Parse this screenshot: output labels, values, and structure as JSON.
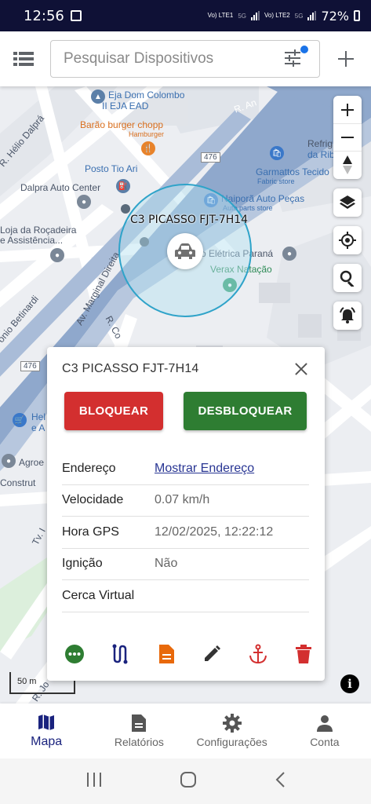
{
  "status_bar": {
    "time": "12:56",
    "sim1": "Vo) LTE1",
    "sim2": "Vo) LTE2",
    "network_badge": "5G",
    "battery": "72%"
  },
  "app_bar": {
    "menu_icon": "list-icon",
    "search_placeholder": "Pesquisar Dispositivos",
    "filter_icon": "filter-sliders-icon",
    "add_icon": "plus-icon"
  },
  "map": {
    "labels": {
      "eja": "Eja Dom Colombo",
      "eja2": "II EJA EAD",
      "barao": "Barão burger chopp",
      "hamburger": "Hamburger",
      "posto": "Posto Tio Ari",
      "dalpra": "Dalpra Auto Center",
      "helio": "R. Hélio Dalprá",
      "loja1": "Loja da Roçadeira",
      "loja2": "e Assistência...",
      "garmattos": "Garmattos Tecido",
      "fabric": "Fabric store",
      "refrig1": "Refrig",
      "refrig2": "da Rib",
      "naipora": "Naiporã Auto Peças",
      "autoparts": "Auto parts store",
      "eletrica": "o Elétrica Paraná",
      "verax": "Verax Natação",
      "marginal": "Av. Marginal Direita",
      "betinardi": "onio Betinardi",
      "rua_r": "R. Co",
      "agro": "Agroe",
      "construt": "Construt",
      "hel1": "Hel",
      "hel2": "e A",
      "route476a": "476",
      "route476b": "476",
      "rua_an": "R. An",
      "tv": "Tv. I",
      "rua_bottom": "R. Jo"
    },
    "vehicle_label": "C3 PICASSO FJT-7H14",
    "scale": "50 m",
    "info": "i"
  },
  "popup": {
    "title": "C3 PICASSO FJT-7H14",
    "block_button": "BLOQUEAR",
    "unblock_button": "DESBLOQUEAR",
    "rows": [
      {
        "key": "Endereço",
        "value": "Mostrar Endereço"
      },
      {
        "key": "Velocidade",
        "value": "0.07 km/h"
      },
      {
        "key": "Hora GPS",
        "value": "12/02/2025, 12:22:12"
      },
      {
        "key": "Ignição",
        "value": "Não"
      },
      {
        "key": "Cerca Virtual",
        "value": ""
      }
    ],
    "actions": [
      "more-icon",
      "route-icon",
      "report-icon",
      "edit-icon",
      "anchor-icon",
      "delete-icon"
    ]
  },
  "bottom_nav": [
    {
      "label": "Mapa",
      "icon": "map-icon",
      "active": true
    },
    {
      "label": "Relatórios",
      "icon": "document-icon",
      "active": false
    },
    {
      "label": "Configurações",
      "icon": "gear-icon",
      "active": false
    },
    {
      "label": "Conta",
      "icon": "person-icon",
      "active": false
    }
  ],
  "colors": {
    "status_bar": "#0f1136",
    "primary": "#1a237e",
    "block": "#d32f2f",
    "unblock": "#2e7d32",
    "geofence": "#2fa3c9"
  }
}
